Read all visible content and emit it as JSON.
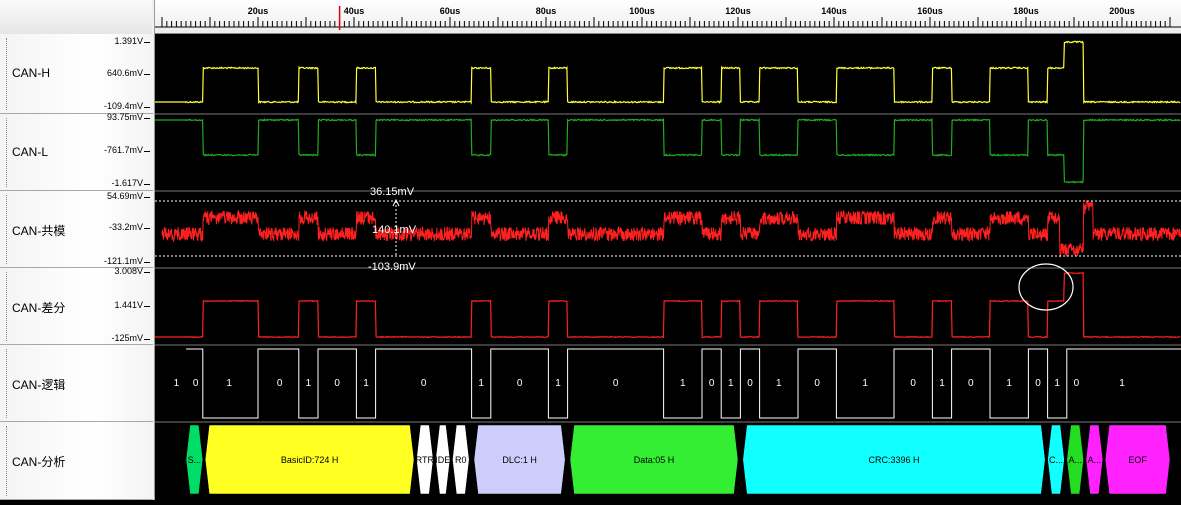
{
  "time_axis": {
    "unit": "us",
    "range_us": [
      0,
      210
    ],
    "labels": [
      {
        "t": 20,
        "text": "20us"
      },
      {
        "t": 40,
        "text": "40us"
      },
      {
        "t": 60,
        "text": "60us"
      },
      {
        "t": 80,
        "text": "80us"
      },
      {
        "t": 100,
        "text": "100us"
      },
      {
        "t": 120,
        "text": "120us"
      },
      {
        "t": 140,
        "text": "140us"
      },
      {
        "t": 160,
        "text": "160us"
      },
      {
        "t": 180,
        "text": "180us"
      },
      {
        "t": 200,
        "text": "200us"
      }
    ],
    "cursor_us": 37
  },
  "channels": [
    {
      "name": "CAN-H",
      "ticks": [
        "1.391V",
        "640.6mV",
        "-109.4mV"
      ],
      "color": "#ffff33"
    },
    {
      "name": "CAN-L",
      "ticks": [
        "93.75mV",
        "-761.7mV",
        "-1.617V"
      ],
      "color": "#22aa22"
    },
    {
      "name": "CAN-共模",
      "ticks": [
        "54.69mV",
        "-33.2mV",
        "-121.1mV"
      ],
      "color": "#ff2020"
    },
    {
      "name": "CAN-差分",
      "ticks": [
        "3.008V",
        "1.441V",
        "-125mV"
      ],
      "color": "#ff2020"
    },
    {
      "name": "CAN-逻辑",
      "ticks": [],
      "color": "#ffffff"
    },
    {
      "name": "CAN-分析",
      "ticks": [],
      "color": "#ffffff"
    }
  ],
  "measurements": {
    "upper": "36.15mV",
    "middle": "140.1mV",
    "lower": "-103.9mV"
  },
  "chart_data": {
    "type": "line",
    "title": "",
    "x_unit": "us",
    "bit_time_us": 2,
    "logic_edges": [
      {
        "t": 5,
        "level": 1
      },
      {
        "t": 8.5,
        "level": 0
      },
      {
        "t": 20,
        "level": 1
      },
      {
        "t": 28.5,
        "level": 0
      },
      {
        "t": 32.5,
        "level": 1
      },
      {
        "t": 40.5,
        "level": 0
      },
      {
        "t": 44.5,
        "level": 1
      },
      {
        "t": 64.5,
        "level": 0
      },
      {
        "t": 68.5,
        "level": 1
      },
      {
        "t": 80.5,
        "level": 0
      },
      {
        "t": 84.5,
        "level": 1
      },
      {
        "t": 104.5,
        "level": 0
      },
      {
        "t": 112.5,
        "level": 1
      },
      {
        "t": 116.5,
        "level": 0
      },
      {
        "t": 120.5,
        "level": 1
      },
      {
        "t": 124.5,
        "level": 0
      },
      {
        "t": 132.5,
        "level": 1
      },
      {
        "t": 140.5,
        "level": 0
      },
      {
        "t": 152.5,
        "level": 1
      },
      {
        "t": 160.5,
        "level": 0
      },
      {
        "t": 164.5,
        "level": 1
      },
      {
        "t": 172.5,
        "level": 0
      },
      {
        "t": 180.5,
        "level": 1
      },
      {
        "t": 184.5,
        "level": 0
      },
      {
        "t": 188.5,
        "level": 1
      },
      {
        "t": 210,
        "level": 1
      }
    ],
    "ack_spike": {
      "start": 188,
      "end": 192
    },
    "bit_labels": [
      {
        "t": 3,
        "text": "1"
      },
      {
        "t": 7,
        "text": "0"
      },
      {
        "t": 14,
        "text": "1"
      },
      {
        "t": 24.5,
        "text": "0"
      },
      {
        "t": 30.5,
        "text": "1"
      },
      {
        "t": 36.5,
        "text": "0"
      },
      {
        "t": 42.5,
        "text": "1"
      },
      {
        "t": 54.5,
        "text": "0"
      },
      {
        "t": 66.5,
        "text": "1"
      },
      {
        "t": 74.5,
        "text": "0"
      },
      {
        "t": 82.5,
        "text": "1"
      },
      {
        "t": 94.5,
        "text": "0"
      },
      {
        "t": 108.5,
        "text": "1"
      },
      {
        "t": 114.5,
        "text": "0"
      },
      {
        "t": 118.5,
        "text": "1"
      },
      {
        "t": 122.5,
        "text": "0"
      },
      {
        "t": 128.5,
        "text": "1"
      },
      {
        "t": 136.5,
        "text": "0"
      },
      {
        "t": 146.5,
        "text": "1"
      },
      {
        "t": 156.5,
        "text": "0"
      },
      {
        "t": 162.5,
        "text": "1"
      },
      {
        "t": 168.5,
        "text": "0"
      },
      {
        "t": 176.5,
        "text": "1"
      },
      {
        "t": 182.5,
        "text": "0"
      },
      {
        "t": 186.5,
        "text": "1"
      },
      {
        "t": 190.5,
        "text": "0"
      },
      {
        "t": 200,
        "text": "1"
      }
    ],
    "protocol_fields": [
      {
        "label": "S...",
        "start": 5,
        "end": 8.5,
        "color": "#00dd66"
      },
      {
        "label": "BasicID:724 H",
        "start": 9,
        "end": 52.5,
        "color": "#ffff22"
      },
      {
        "label": "RTR",
        "start": 53,
        "end": 56.5,
        "color": "#ffffff"
      },
      {
        "label": "IDE",
        "start": 57,
        "end": 60,
        "color": "#ffffff"
      },
      {
        "label": "R0",
        "start": 60.5,
        "end": 64,
        "color": "#ffffff"
      },
      {
        "label": "DLC:1 H",
        "start": 65,
        "end": 84,
        "color": "#cccdfa"
      },
      {
        "label": "Data:05 H",
        "start": 85,
        "end": 120,
        "color": "#33ee33"
      },
      {
        "label": "CRC:3396 H",
        "start": 121,
        "end": 184,
        "color": "#11ffff"
      },
      {
        "label": "C...",
        "start": 184.5,
        "end": 188,
        "color": "#11ffff"
      },
      {
        "label": "A...",
        "start": 188.5,
        "end": 192,
        "color": "#22dd22"
      },
      {
        "label": "A...",
        "start": 192.5,
        "end": 196,
        "color": "#ff22ff"
      },
      {
        "label": "EOF",
        "start": 196.5,
        "end": 210,
        "color": "#ff22ff"
      }
    ]
  }
}
